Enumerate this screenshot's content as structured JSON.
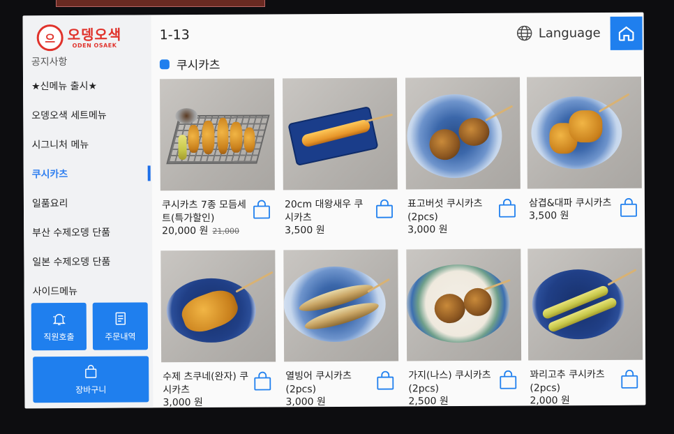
{
  "brand": {
    "logo_mark": "으",
    "name_kr": "오뎅오색",
    "name_en": "ODEN OSAEK"
  },
  "header": {
    "table_number": "1-13",
    "language_label": "Language"
  },
  "sidebar": {
    "items": [
      {
        "label": "공지사항"
      },
      {
        "label": "★신메뉴 출시★"
      },
      {
        "label": "오뎅오색 세트메뉴"
      },
      {
        "label": "시그니처 메뉴"
      },
      {
        "label": "쿠시카츠"
      },
      {
        "label": "일품요리"
      },
      {
        "label": "부산 수제오뎅 단품"
      },
      {
        "label": "일본 수제오뎅 단품"
      },
      {
        "label": "사이드메뉴"
      }
    ],
    "active_index": 4,
    "call_staff_label": "직원호출",
    "order_history_label": "주문내역",
    "cart_label": "장바구니"
  },
  "category": {
    "title": "쿠시카츠"
  },
  "products": [
    {
      "name": "쿠시카츠 7종 모듬세트(특가할인)",
      "price": "20,000 원",
      "old_price": "21,000"
    },
    {
      "name": "20cm 대왕새우 쿠시카츠",
      "price": "3,500 원"
    },
    {
      "name": "표고버섯 쿠시카츠(2pcs)",
      "price": "3,000 원"
    },
    {
      "name": "삼겹&대파 쿠시카츠",
      "price": "3,500 원"
    },
    {
      "name": "수제 츠쿠네(완자) 쿠시카츠",
      "price": "3,000 원"
    },
    {
      "name": "열빙어 쿠시카츠(2pcs)",
      "price": "3,000 원"
    },
    {
      "name": "가지(나스) 쿠시카츠(2pcs)",
      "price": "2,500 원"
    },
    {
      "name": "꽈리고추 쿠시카츠(2pcs)",
      "price": "2,000 원"
    }
  ],
  "colors": {
    "accent": "#1f7fee",
    "brand_red": "#e0322b",
    "active_text": "#2f7ff0"
  }
}
